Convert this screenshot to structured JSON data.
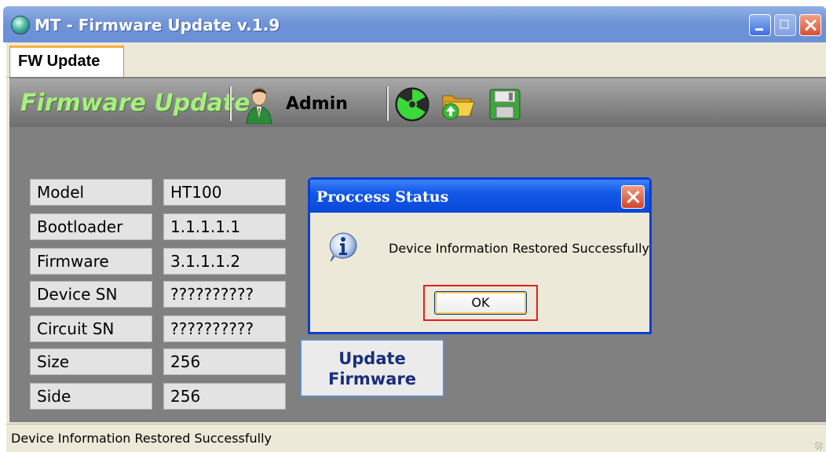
{
  "window": {
    "title": "MT - Firmware Update v.1.9"
  },
  "tabs": [
    {
      "label": "FW Update"
    }
  ],
  "header": {
    "title": "Firmware Update",
    "user": "Admin"
  },
  "info": [
    {
      "label": "Model",
      "value": "HT100"
    },
    {
      "label": "Bootloader",
      "value": "1.1.1.1.1"
    },
    {
      "label": "Firmware",
      "value": "3.1.1.1.2"
    },
    {
      "label": "Device SN",
      "value": "??????????"
    },
    {
      "label": "Circuit SN",
      "value": "??????????"
    },
    {
      "label": "Size",
      "value": "256"
    },
    {
      "label": "Side",
      "value": "256"
    }
  ],
  "update_button": {
    "line1": "Update",
    "line2": "Firmware"
  },
  "dialog": {
    "title": "Proccess Status",
    "message": "Device Information Restored Successfully",
    "ok_label": "OK"
  },
  "status_bar": {
    "text": "Device Information Restored Successfully"
  },
  "icons": [
    "app-icon",
    "user-icon",
    "radiation-icon",
    "open-folder-icon",
    "save-icon",
    "info-icon",
    "close-icon"
  ]
}
